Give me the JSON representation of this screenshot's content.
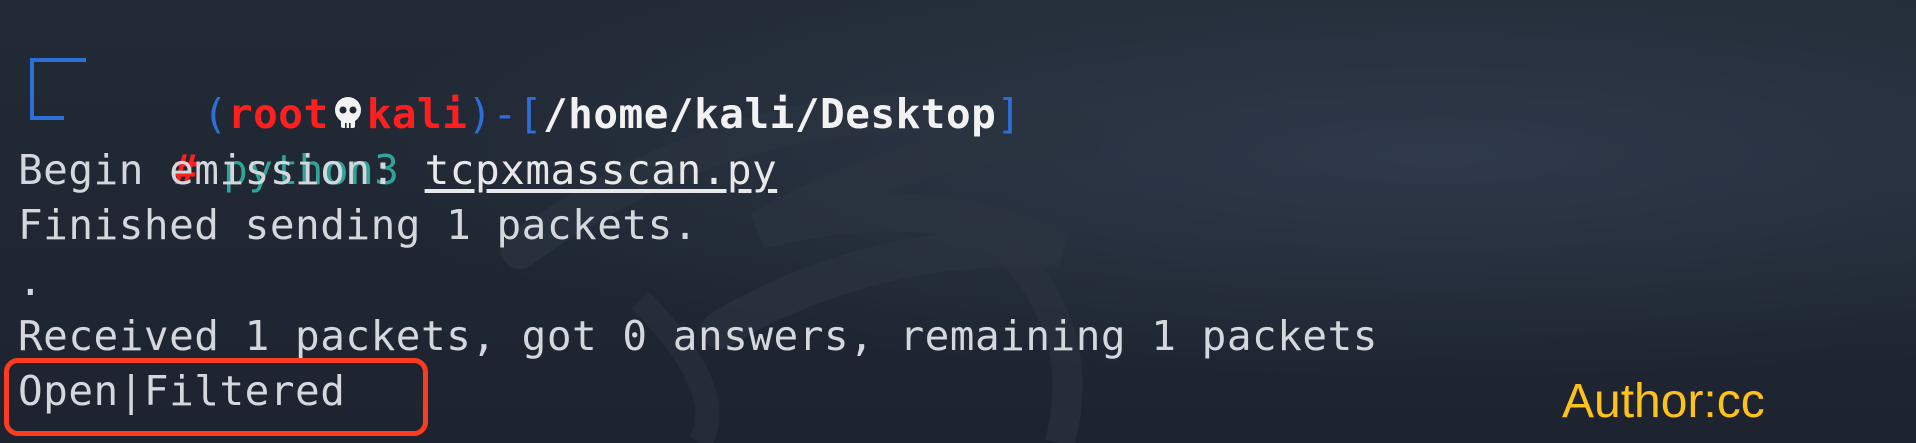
{
  "prompt": {
    "user": "root",
    "host": "kali",
    "cwd": "/home/kali/Desktop",
    "symbol": "#",
    "open_paren": "(",
    "close_paren": ")",
    "dash": "-",
    "open_bracket": "[",
    "close_bracket": "]"
  },
  "command": {
    "program": "python3",
    "argument": "tcpxmasscan.py"
  },
  "output": [
    "Begin emission:",
    "Finished sending 1 packets.",
    ".",
    "Received 1 packets, got 0 answers, remaining 1 packets",
    "Open|Filtered"
  ],
  "watermark": {
    "author": "Author:cc"
  },
  "colors": {
    "background": "#1f2631",
    "prompt_blue": "#2c6fd6",
    "prompt_red": "#ff1f1f",
    "command_teal": "#30a49a",
    "highlight_box": "#ff3b1f",
    "author_text": "#ffc21a"
  }
}
